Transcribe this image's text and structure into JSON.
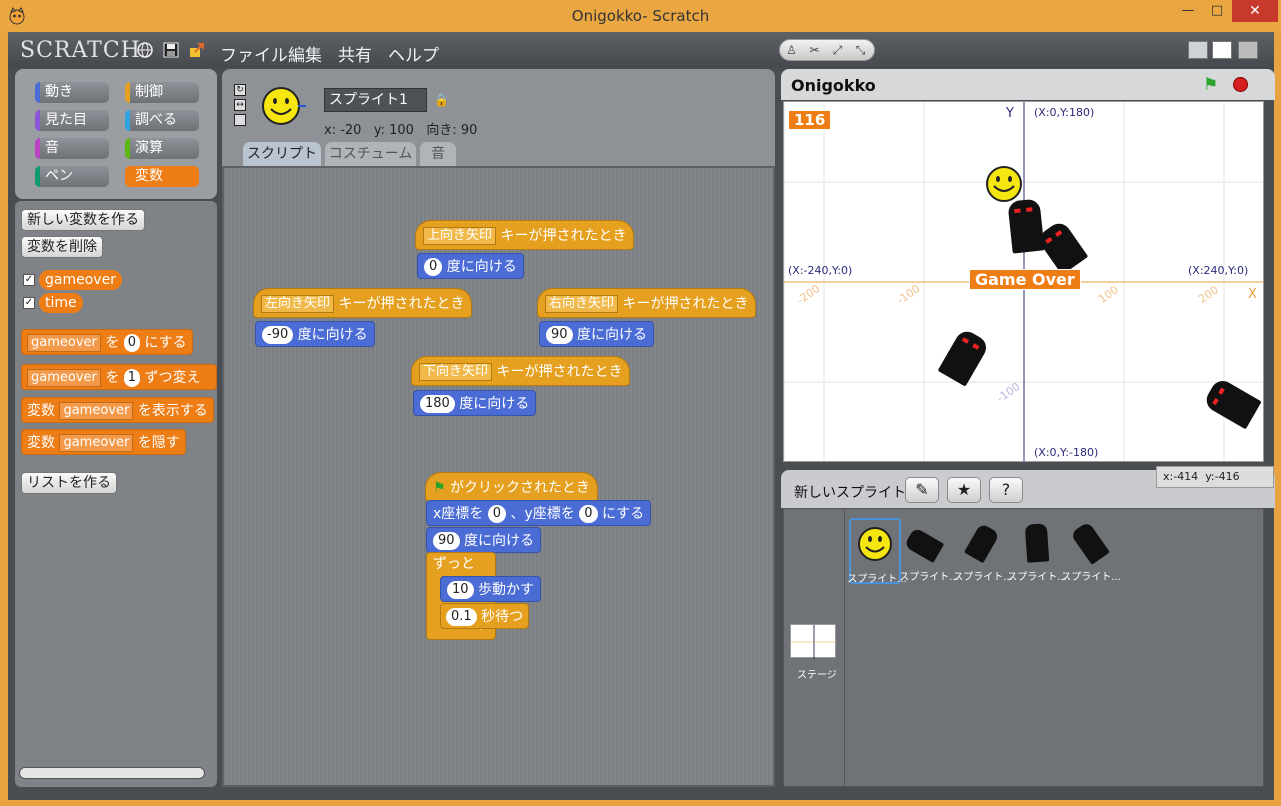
{
  "window": {
    "title": "Onigokko- Scratch",
    "minimize": "—",
    "maximize": "□",
    "close": "✕"
  },
  "menubar": {
    "logo": "SCRATCH",
    "items": [
      "ファイル",
      "編集",
      "共有",
      "ヘルプ"
    ]
  },
  "categories": [
    {
      "label": "動き",
      "color": "#4a6cd4"
    },
    {
      "label": "制御",
      "color": "#e6a01f"
    },
    {
      "label": "見た目",
      "color": "#8a55d7"
    },
    {
      "label": "調べる",
      "color": "#2ca5e2"
    },
    {
      "label": "音",
      "color": "#bb42c3"
    },
    {
      "label": "演算",
      "color": "#5cb712"
    },
    {
      "label": "ペン",
      "color": "#0e9a6c"
    },
    {
      "label": "変数",
      "color": "#ee7d16",
      "selected": true
    }
  ],
  "palette": {
    "new_var": "新しい変数を作る",
    "del_var": "変数を削除",
    "vars": [
      "gameover",
      "time"
    ],
    "set_block": {
      "var": "gameover",
      "pre": "を",
      "val": "0",
      "post": "にする"
    },
    "change_block": {
      "var": "gameover",
      "pre": "を",
      "val": "1",
      "post": "ずつ変える"
    },
    "show_block": {
      "pre": "変数",
      "var": "gameover",
      "post": "を表示する"
    },
    "hide_block": {
      "pre": "変数",
      "var": "gameover",
      "post": "を隠す"
    },
    "make_list": "リストを作る"
  },
  "sprite": {
    "name": "スプライト1",
    "x_label": "x:",
    "x": "-20",
    "y_label": "y:",
    "y": "100",
    "dir_label": "向き:",
    "dir": "90"
  },
  "tabs": [
    "スクリプト",
    "コスチューム",
    "音"
  ],
  "scripts": {
    "key_suffix": "キーが押されたとき",
    "point_suffix": "度に向ける",
    "up": {
      "key": "上向き矢印",
      "deg": "0"
    },
    "left": {
      "key": "左向き矢印",
      "deg": "-90"
    },
    "right": {
      "key": "右向き矢印",
      "deg": "90"
    },
    "down": {
      "key": "下向き矢印",
      "deg": "180"
    },
    "flag": {
      "hat": "がクリックされたとき",
      "goto_x": "x座標を",
      "x": "0",
      "goto_y": "、y座標を",
      "y": "0",
      "goto_post": "にする",
      "dir": "90",
      "forever": "ずっと",
      "steps": "10",
      "move": "歩動かす",
      "wait": "0.1",
      "wait_post": "秒待つ"
    }
  },
  "stage": {
    "title": "Onigokko",
    "timer": "116",
    "game_over": "Game Over",
    "top_label": "(X:0,Y:180)",
    "bottom_label": "(X:0,Y:-180)",
    "left_label": "(X:-240,Y:0)",
    "right_label": "(X:240,Y:0)",
    "axis_x": "X",
    "axis_y": "Y",
    "ticks": [
      "-200",
      "-100",
      "100",
      "200",
      "-100"
    ]
  },
  "mouse": {
    "x_label": "x:",
    "x": "-414",
    "y_label": "y:",
    "y": "-416"
  },
  "sprites_panel": {
    "new_sprite": "新しいスプライト:",
    "items": [
      "スプライト...",
      "スプライト...",
      "スプライト...",
      "スプライト...",
      "スプライト..."
    ],
    "stage_label": "ステージ"
  }
}
